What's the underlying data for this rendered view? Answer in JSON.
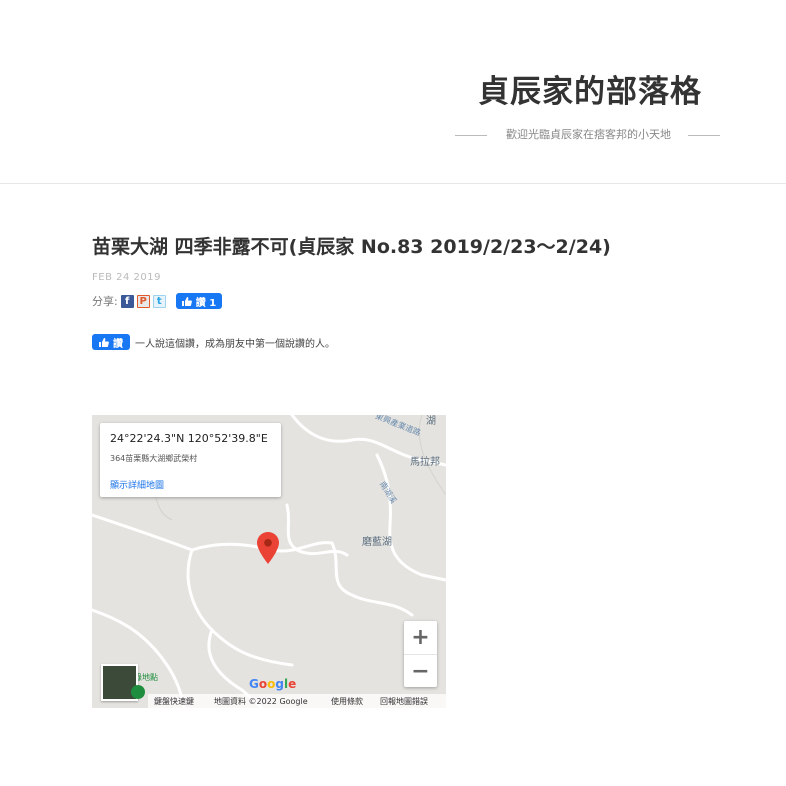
{
  "blog": {
    "title": "貞辰家的部落格",
    "tagline": "歡迎光臨貞辰家在痞客邦的小天地"
  },
  "post": {
    "title": "苗栗大湖 四季非露不可(貞辰家 No.83 2019/2/23～2/24)",
    "date": "FEB 24 2019",
    "share_label": "分享:",
    "share_icons": [
      "facebook-icon",
      "plurk-icon",
      "twitter-icon"
    ],
    "like_label": "讚 1",
    "like_button_label": "讚",
    "like_text": "一人說這個讚，成為朋友中第一個說讚的人。"
  },
  "map": {
    "coordinates": "24°22'24.3\"N 120°52'39.8\"E",
    "address": "364苗栗縣大湖鄉武榮村",
    "more_link": "顯示詳細地圖",
    "labels": {
      "road_top": "東興產業道路",
      "town": "馬拉邦",
      "road_right": "南湖溪",
      "lake": "磨藍湖",
      "corner": "湖",
      "green_place": "綠地點"
    },
    "zoom_in": "+",
    "zoom_out": "−",
    "google_logo": {
      "g1": "G",
      "o1": "o",
      "o2": "o",
      "g2": "g",
      "l": "l",
      "e": "e"
    },
    "attribution": {
      "shortcuts": "鍵盤快速鍵",
      "data": "地圖資料 ©2022 Google",
      "terms": "使用條款",
      "report": "回報地圖錯誤"
    },
    "colors": {
      "background": "#e5e3df",
      "pin": "#ea4335",
      "link": "#1a73e8"
    }
  }
}
